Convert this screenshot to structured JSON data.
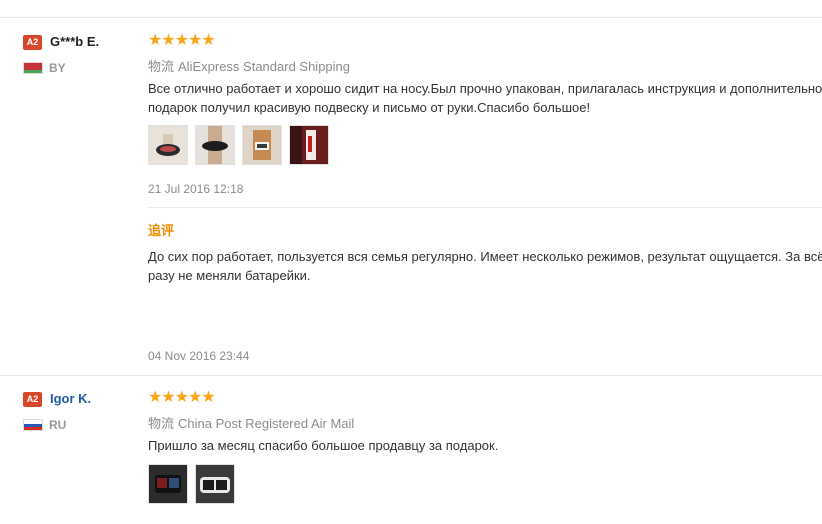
{
  "reviews": [
    {
      "badge": "A2",
      "name": "G***b E.",
      "country": "BY",
      "rating": "★★★★★",
      "shipping_label": "物流",
      "shipping": "AliExpress Standard Shipping",
      "text_line1": "Все отлично работает и хорошо сидит на носу.Был прочно упакован, прилагалась инструкция и дополнительно",
      "text_line2": "подарок получил красивую подвеску и письмо от руки.Спасибо большое!",
      "date": "21 Jul 2016 12:18",
      "additional": {
        "label": "追评",
        "text_line1": "До сих пор работает, пользуется вся семья регулярно. Имеет несколько режимов, результат ощущается. За всё",
        "text_line2": "разу не меняли батарейки.",
        "date": "04 Nov 2016 23:44"
      }
    },
    {
      "badge": "A2",
      "name": "Igor K.",
      "country": "RU",
      "rating": "★★★★★",
      "shipping_label": "物流",
      "shipping": "China Post Registered Air Mail",
      "text_line1": "Пришло за месяц спасибо большое продавцу за подарок."
    }
  ],
  "colors": {
    "star": "#f8a51a",
    "badge": "#d9472b",
    "link": "#1f5ba8",
    "accent": "#f08c00"
  },
  "icons": [
    "belarus-flag-icon",
    "russia-flag-icon",
    "star-icon"
  ]
}
